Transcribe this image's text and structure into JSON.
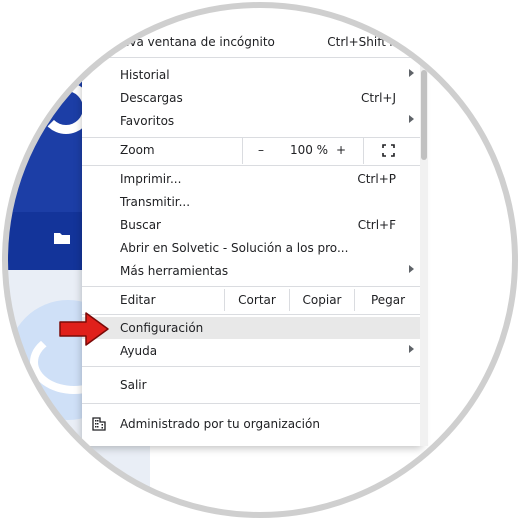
{
  "menu": {
    "partial_top": "tana",
    "incognito": {
      "label": "eva ventana de incógnito",
      "shortcut": "Ctrl+Shift+"
    },
    "history": "Historial",
    "downloads": {
      "label": "Descargas",
      "shortcut": "Ctrl+J"
    },
    "bookmarks": "Favoritos",
    "zoom": {
      "label": "Zoom",
      "minus": "–",
      "value": "100 %",
      "plus": "+"
    },
    "print": {
      "label": "Imprimir...",
      "shortcut": "Ctrl+P"
    },
    "cast": "Transmitir...",
    "find": {
      "label": "Buscar",
      "shortcut": "Ctrl+F"
    },
    "open_in": "Abrir en Solvetic - Solución a los pro...",
    "more_tools": "Más herramientas",
    "edit": {
      "label": "Editar",
      "cut": "Cortar",
      "copy": "Copiar",
      "paste": "Pegar"
    },
    "settings": "Configuración",
    "help": "Ayuda",
    "exit": "Salir",
    "managed": "Administrado por tu organización"
  },
  "colors": {
    "accent_arrow": "#e0201b",
    "highlight": "#e8e8e8",
    "page_blue": "#1c3ea6"
  },
  "icons": [
    "folder-icon",
    "fullscreen-icon",
    "building-icon",
    "red-arrow-icon",
    "chevron-right-icon"
  ]
}
